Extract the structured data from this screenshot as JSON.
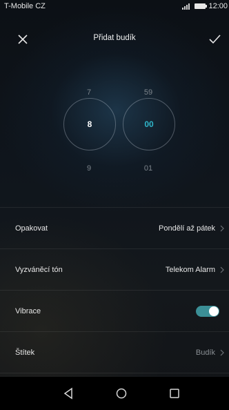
{
  "status_bar": {
    "carrier": "T-Mobile CZ",
    "time": "12:00",
    "icons": [
      "signal-icon",
      "battery-icon"
    ]
  },
  "header": {
    "title": "Přidat budík",
    "left_icon": "close-icon",
    "right_icon": "checkmark-icon"
  },
  "time_picker": {
    "hour": {
      "prev": "7",
      "selected": "8",
      "next": "9"
    },
    "minute": {
      "prev": "59",
      "selected": "00",
      "next": "01"
    },
    "accent_color": "#2fb5c9"
  },
  "settings": {
    "repeat": {
      "label": "Opakovat",
      "value": "Pondělí až pátek"
    },
    "ringtone": {
      "label": "Vyzváněcí tón",
      "value": "Telekom Alarm"
    },
    "vibration": {
      "label": "Vibrace",
      "enabled": true
    },
    "tag": {
      "label": "Štítek",
      "value": "Budík"
    }
  },
  "nav_bar": {
    "icons": [
      "back-icon",
      "home-icon",
      "recent-apps-icon"
    ]
  }
}
